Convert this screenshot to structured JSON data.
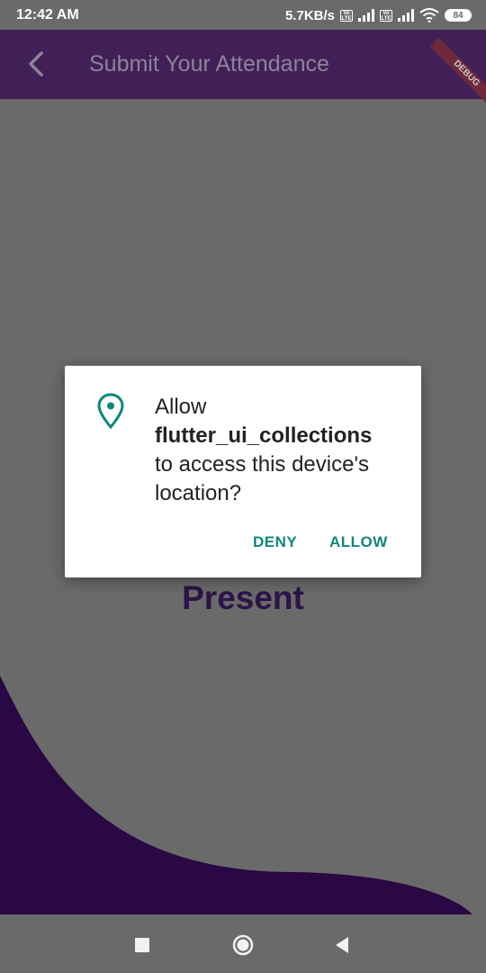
{
  "status_bar": {
    "time": "12:42 AM",
    "network_speed": "5.7KB/s",
    "volte_label": "Vo LTE",
    "battery_level": "84"
  },
  "app_bar": {
    "title": "Submit Your Attendance",
    "debug_banner": "DEBUG",
    "color": "#412058"
  },
  "content": {
    "status_label": "Present",
    "wave_color": "#2a0843",
    "background": "#6a6a6a"
  },
  "dialog": {
    "prefix": "Allow",
    "app_name": "flutter_ui_collections",
    "suffix": "to access this device's location?",
    "deny_label": "DENY",
    "allow_label": "ALLOW",
    "accent": "#10867a",
    "icon": "location-pin-icon"
  },
  "nav_bar": {
    "icons": [
      "recents-square-icon",
      "home-circle-icon",
      "back-triangle-icon"
    ]
  }
}
